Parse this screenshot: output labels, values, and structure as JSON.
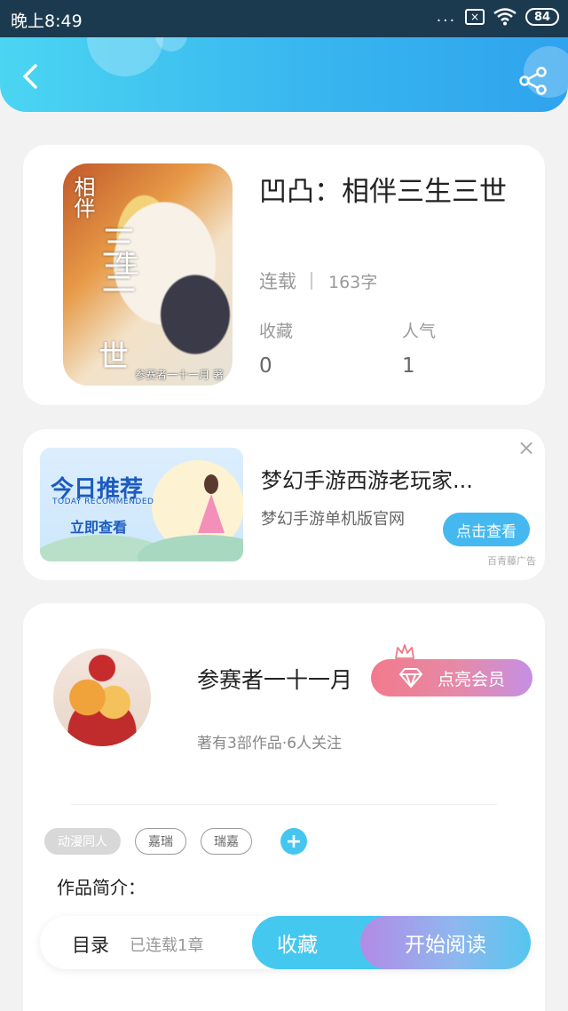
{
  "status_bar": {
    "time": "晚上8:49",
    "dots": "...",
    "sim_icon_text": "×",
    "battery": "84"
  },
  "header": {
    "back_icon": "chevron-left-icon",
    "share_icon": "share-icon"
  },
  "book": {
    "title": "凹凸：相伴三生三世",
    "cover_text_small": "相伴",
    "cover_text_big": "三三",
    "cover_text_side": "生",
    "cover_text_bottom": "世",
    "cover_author": "参赛者一十一月 著",
    "status": "连载",
    "word_count": "163字",
    "favorites_label": "收藏",
    "favorites_value": "0",
    "popularity_label": "人气",
    "popularity_value": "1"
  },
  "ad": {
    "image_title": "今日推荐",
    "image_subtitle": "TODAY RECOMMENDED",
    "image_cta": "立即查看",
    "title": "梦幻手游西游老玩家...",
    "description": "梦幻手游单机版官网",
    "button": "点击查看",
    "close": "×",
    "source": "百青藤广告"
  },
  "author": {
    "name": "参赛者一十一月",
    "vip_button": "点亮会员",
    "stats": "著有3部作品·6人关注",
    "tags": [
      "动漫同人",
      "嘉瑞",
      "瑞嘉"
    ],
    "add_tag": "+",
    "intro_label": "作品简介："
  },
  "bottom_bar": {
    "toc": "目录",
    "progress": "已连载1章",
    "favorite": "收藏",
    "read": "开始阅读"
  },
  "colors": {
    "accent": "#45c8ef",
    "header_start": "#4bd5f2",
    "header_end": "#2fa3ee",
    "vip_start": "#f27a8c",
    "vip_end": "#c58fe4"
  }
}
